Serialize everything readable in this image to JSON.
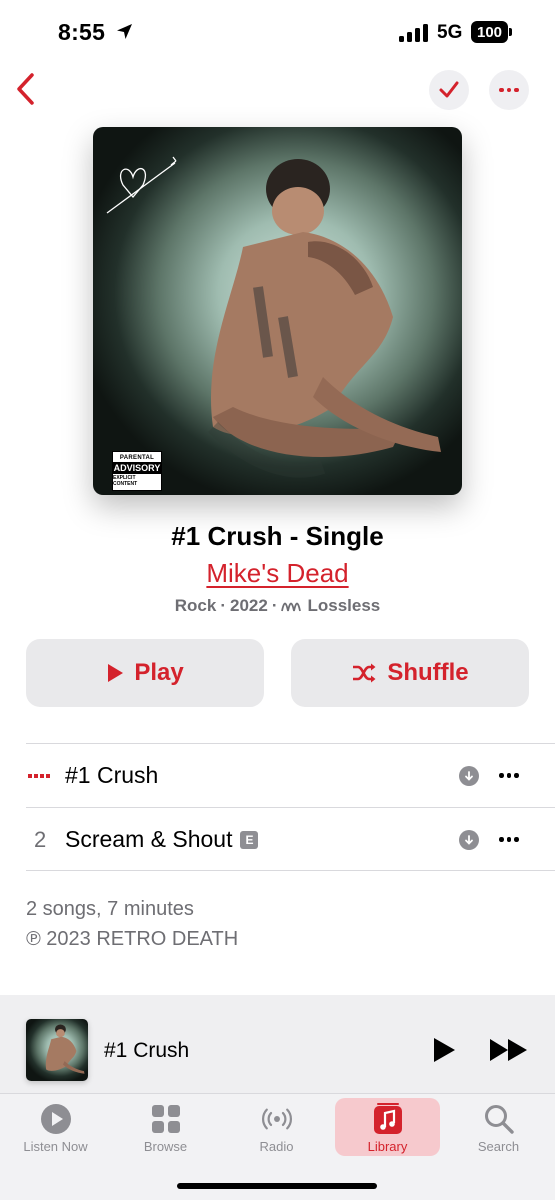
{
  "status_bar": {
    "time": "8:55",
    "network": "5G",
    "battery": "100"
  },
  "nav": {
    "back_icon": "chevron-left-icon",
    "check_icon": "checkmark-icon",
    "more_icon": "ellipsis-icon"
  },
  "artwork": {
    "parental_line1": "PARENTAL",
    "parental_line2": "ADVISORY",
    "parental_line3": "EXPLICIT CONTENT"
  },
  "album": {
    "title": "#1 Crush - Single",
    "artist": "Mike's Dead",
    "genre": "Rock",
    "year": "2022",
    "quality": "Lossless"
  },
  "actions": {
    "play_label": "Play",
    "shuffle_label": "Shuffle"
  },
  "tracks": [
    {
      "number": "",
      "title": "#1 Crush",
      "explicit": false,
      "now_playing": true
    },
    {
      "number": "2",
      "title": "Scream & Shout",
      "explicit": true,
      "explicit_badge": "E",
      "now_playing": false
    }
  ],
  "summary": "2 songs, 7 minutes",
  "copyright": "℗ 2023 RETRO DEATH",
  "mini_player": {
    "title": "#1 Crush"
  },
  "tabs": [
    {
      "label": "Listen Now",
      "icon": "play-circle-icon",
      "active": false
    },
    {
      "label": "Browse",
      "icon": "grid-icon",
      "active": false
    },
    {
      "label": "Radio",
      "icon": "radio-waves-icon",
      "active": false
    },
    {
      "label": "Library",
      "icon": "music-note-icon",
      "active": true
    },
    {
      "label": "Search",
      "icon": "search-icon",
      "active": false
    }
  ],
  "colors": {
    "accent": "#d4222c",
    "secondary_text": "#6e6e73",
    "button_bg": "#e9e9eb"
  }
}
